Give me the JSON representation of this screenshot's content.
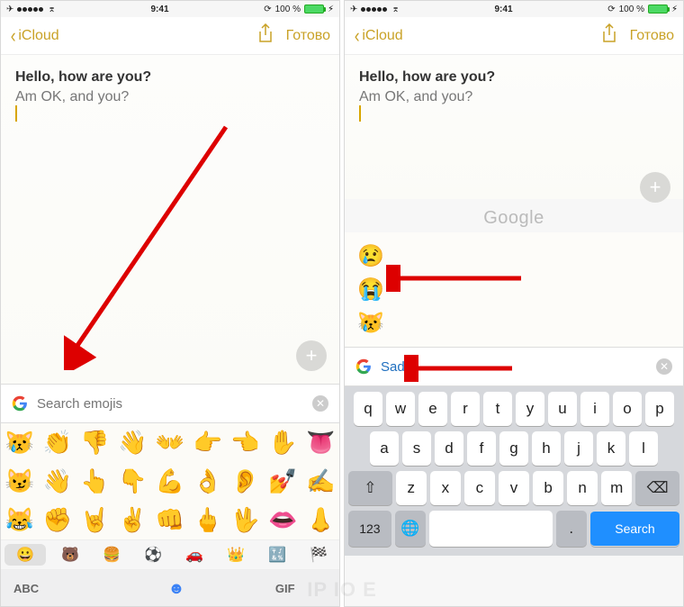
{
  "status": {
    "time": "9:41",
    "battery_pct": "100 %"
  },
  "nav": {
    "back_label": "iCloud",
    "done_label": "Готово"
  },
  "note": {
    "line1": "Hello, how are you?",
    "line2": "Am OK, and you?"
  },
  "search": {
    "placeholder": "Search emojis",
    "value_right": "Sad"
  },
  "google_header": "Google",
  "emoji_rows": [
    [
      "😿",
      "👏",
      "👎",
      "👋",
      "👐",
      "👉",
      "👈",
      "✋",
      "👅"
    ],
    [
      "😼",
      "👋",
      "👆",
      "👇",
      "💪",
      "👌",
      "👂",
      "💅",
      "✍️"
    ],
    [
      "😹",
      "✊",
      "🤘",
      "✌️",
      "👊",
      "🖕",
      "🖖",
      "👄",
      "👃"
    ]
  ],
  "emoji_categories": [
    "😀",
    "🐻",
    "🍔",
    "⚽",
    "🚗",
    "👑",
    "🔣",
    "🏁"
  ],
  "bottom": {
    "abc": "ABC",
    "gif": "GIF"
  },
  "results": [
    "😢",
    "😭",
    "😿"
  ],
  "kbd": {
    "row1": [
      "q",
      "w",
      "e",
      "r",
      "t",
      "y",
      "u",
      "i",
      "o",
      "p"
    ],
    "row2": [
      "a",
      "s",
      "d",
      "f",
      "g",
      "h",
      "j",
      "k",
      "l"
    ],
    "row3": [
      "z",
      "x",
      "c",
      "v",
      "b",
      "n",
      "m"
    ],
    "num": "123",
    "search": "Search"
  }
}
